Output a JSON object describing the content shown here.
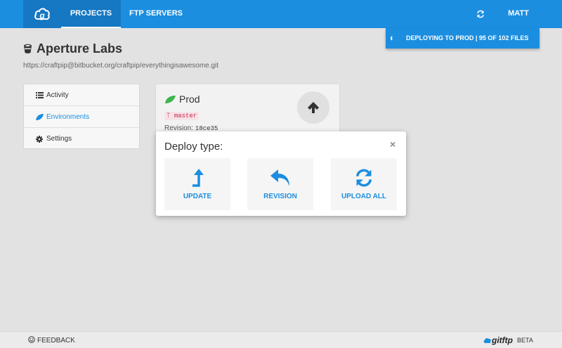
{
  "nav": {
    "projects_label": "PROJECTS",
    "ftp_servers_label": "FTP SERVERS",
    "user_label": "MATT",
    "refresh_icon": "refresh-icon"
  },
  "deploy_status": {
    "text": "DEPLOYING TO PROD | 95 OF 102 FILES",
    "files_done": 95,
    "files_total": 102
  },
  "project": {
    "name": "Aperture Labs",
    "repo_url": "https://craftpip@bitbucket.org/craftpip/everythingisawesome.git",
    "icon": "bucket-icon"
  },
  "side_menu": {
    "items": [
      {
        "label": "Activity",
        "icon": "list-icon",
        "active": false
      },
      {
        "label": "Environments",
        "icon": "leaf-icon",
        "active": true
      },
      {
        "label": "Settings",
        "icon": "gear-icon",
        "active": false
      }
    ]
  },
  "environment": {
    "name": "Prod",
    "branch": "master",
    "revision_label": "Revision:",
    "revision_hash": "18ce35"
  },
  "deploy_popover": {
    "title": "Deploy type:",
    "close_symbol": "×",
    "options": [
      {
        "label": "UPDATE",
        "icon": "level-up-icon"
      },
      {
        "label": "REVISION",
        "icon": "reply-icon"
      },
      {
        "label": "UPLOAD ALL",
        "icon": "refresh-icon"
      }
    ]
  },
  "footer": {
    "feedback_label": "FEEDBACK",
    "brand_logo": "gitftp",
    "brand_suffix": "BETA"
  },
  "colors": {
    "accent": "#1b8ee0",
    "accent_dark": "#1677c2",
    "env_green": "#3cb54a",
    "branch_red": "#c7254e"
  }
}
